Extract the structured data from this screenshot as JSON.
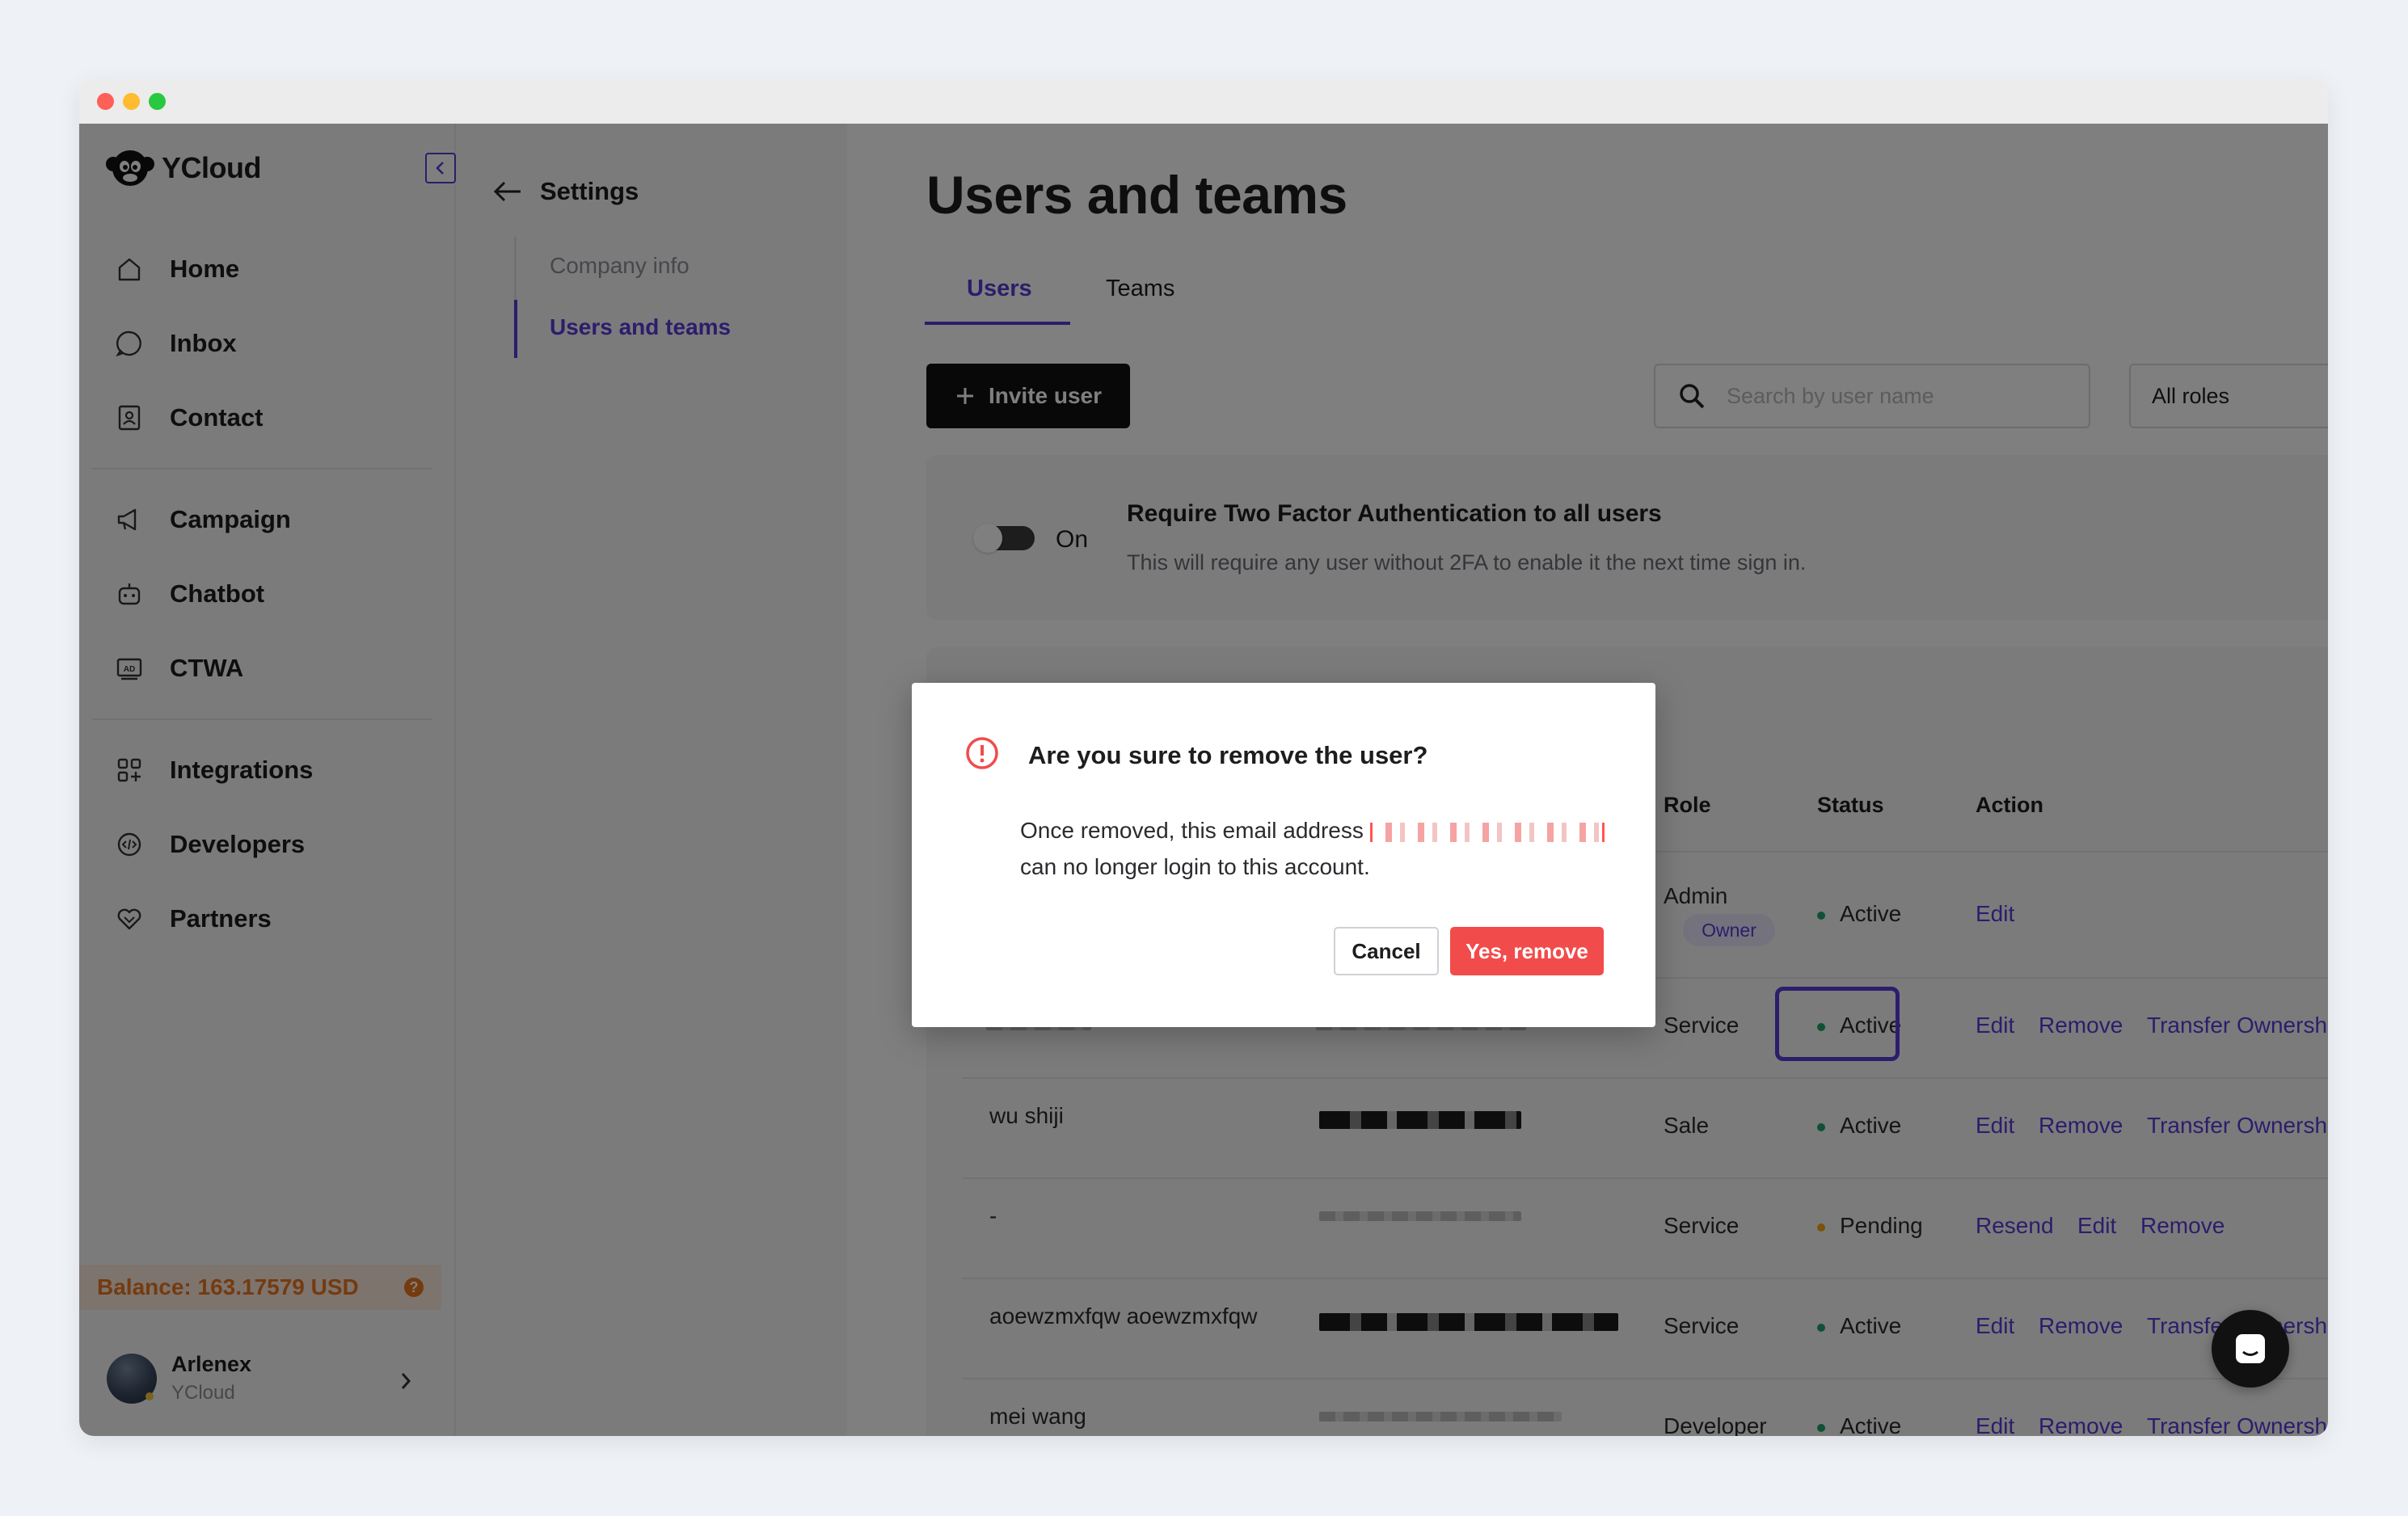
{
  "app": {
    "name": "YCloud"
  },
  "sidebar": {
    "items": [
      {
        "label": "Home",
        "icon": "home-icon"
      },
      {
        "label": "Inbox",
        "icon": "chat-icon"
      },
      {
        "label": "Contact",
        "icon": "contact-icon"
      },
      {
        "label": "Campaign",
        "icon": "megaphone-icon"
      },
      {
        "label": "Chatbot",
        "icon": "robot-icon"
      },
      {
        "label": "CTWA",
        "icon": "ad-icon"
      },
      {
        "label": "Integrations",
        "icon": "grid-plus-icon"
      },
      {
        "label": "Developers",
        "icon": "code-icon"
      },
      {
        "label": "Partners",
        "icon": "handshake-icon"
      }
    ],
    "balance": "Balance: 163.17579 USD",
    "user": {
      "name": "Arlenex",
      "org": "YCloud"
    }
  },
  "settings": {
    "title": "Settings",
    "links": [
      {
        "label": "Company info",
        "active": false
      },
      {
        "label": "Users and teams",
        "active": true
      }
    ]
  },
  "main": {
    "title": "Users and teams",
    "tabs": [
      {
        "label": "Users",
        "active": true
      },
      {
        "label": "Teams",
        "active": false
      }
    ],
    "invite_label": "Invite user",
    "search_placeholder": "Search by user name",
    "roles_value": "All roles",
    "tfa": {
      "toggle_label": "On",
      "title": "Require Two Factor Authentication to all users",
      "description": "This will require any user without 2FA to enable it the next time sign in."
    },
    "table": {
      "headers": {
        "role": "Role",
        "status": "Status",
        "action": "Action"
      },
      "rows": [
        {
          "name": "",
          "role": "Admin",
          "badge": "Owner",
          "status": "Active",
          "actions": [
            "Edit"
          ]
        },
        {
          "name": "",
          "role": "Service",
          "status": "Active",
          "actions": [
            "Edit",
            "Remove",
            "Transfer Ownersh"
          ]
        },
        {
          "name": "wu shiji",
          "role": "Sale",
          "status": "Active",
          "actions": [
            "Edit",
            "Remove",
            "Transfer Ownersh"
          ]
        },
        {
          "name": "-",
          "role": "Service",
          "status": "Pending",
          "actions": [
            "Resend",
            "Edit",
            "Remove"
          ]
        },
        {
          "name": "aoewzmxfqw aoewzmxfqw",
          "role": "Service",
          "status": "Active",
          "actions": [
            "Edit",
            "Remove",
            "Transfer Ownersh"
          ]
        },
        {
          "name": "mei wang",
          "role": "Developer",
          "status": "Active",
          "actions": [
            "Edit",
            "Remove",
            "Transfer Ownersh"
          ]
        }
      ]
    }
  },
  "modal": {
    "title": "Are you sure to remove the user?",
    "body_prefix": "Once removed, this email address",
    "body_suffix": "can no longer login to this account.",
    "cancel_label": "Cancel",
    "confirm_label": "Yes, remove"
  },
  "colors": {
    "accent": "#5b3bd6",
    "danger": "#f24b4b",
    "active_dot": "#22a06b",
    "pending_dot": "#f2a516",
    "balance": "#e8761e"
  }
}
